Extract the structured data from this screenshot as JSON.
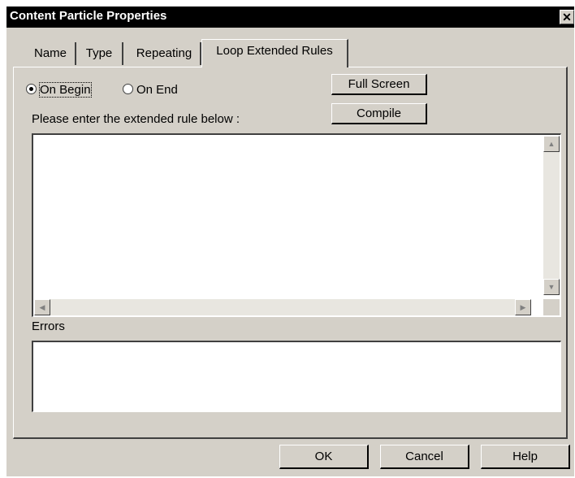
{
  "window": {
    "title": "Content Particle Properties",
    "close_glyph": "✕"
  },
  "tabs": [
    {
      "label": "Name",
      "active": false
    },
    {
      "label": "Type",
      "active": false
    },
    {
      "label": "Repeating",
      "active": false
    },
    {
      "label": "Loop Extended Rules",
      "active": true
    }
  ],
  "rule_timing": {
    "options": [
      {
        "label": "On Begin",
        "checked": true
      },
      {
        "label": "On End",
        "checked": false
      }
    ]
  },
  "buttons": {
    "full_screen": "Full Screen",
    "compile": "Compile",
    "ok": "OK",
    "cancel": "Cancel",
    "help": "Help"
  },
  "editor": {
    "prompt": "Please enter the extended rule below :",
    "value": ""
  },
  "errors": {
    "label": "Errors",
    "value": ""
  },
  "icons": {
    "scroll_up": "up-arrow-icon",
    "scroll_down": "down-arrow-icon",
    "scroll_left": "left-arrow-icon",
    "scroll_right": "right-arrow-icon"
  }
}
